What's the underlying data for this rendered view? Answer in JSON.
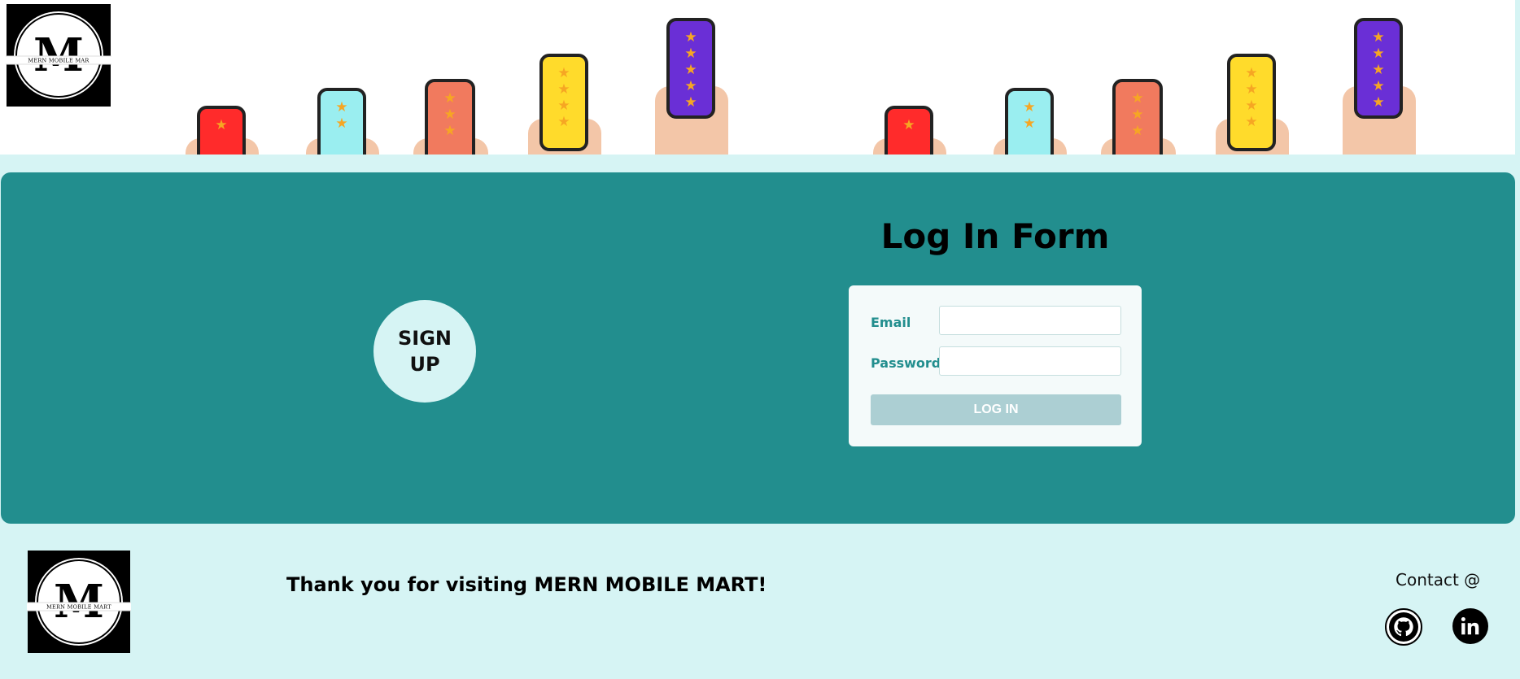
{
  "brand": {
    "logo_initial": "M",
    "logo_text_header": "MERN MOBILE MAR",
    "logo_text_footer": "MERN MOBILE MART"
  },
  "banner": {
    "phones": [
      {
        "screen": "#ff2b2b",
        "stars": 1
      },
      {
        "screen": "#9aeef0",
        "stars": 2
      },
      {
        "screen": "#f17a5e",
        "stars": 3
      },
      {
        "screen": "#ffdb2b",
        "stars": 4
      },
      {
        "screen": "#6a2fd6",
        "stars": 5
      }
    ]
  },
  "main": {
    "signup_label": "SIGN UP",
    "form_title": "Log In Form",
    "email_label": "Email",
    "email_value": "",
    "password_label": "Password",
    "password_value": "",
    "login_button": "LOG IN"
  },
  "footer": {
    "thanks": "Thank you for visiting MERN MOBILE MART!",
    "contact": "Contact @",
    "social": [
      "github-icon",
      "linkedin-icon"
    ]
  },
  "colors": {
    "page_bg": "#d6f4f4",
    "panel": "#228e8e",
    "card": "#f4fafa",
    "button_disabled": "#accfd3"
  }
}
